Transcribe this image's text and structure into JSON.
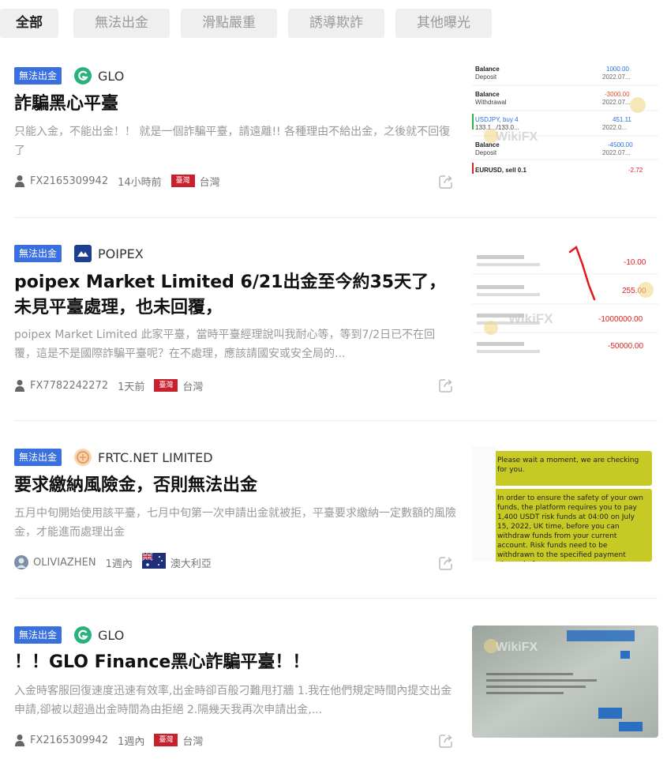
{
  "tabs": [
    {
      "label": "全部",
      "active": true
    },
    {
      "label": "無法出金",
      "active": false
    },
    {
      "label": "滑點嚴重",
      "active": false
    },
    {
      "label": "誘導欺詐",
      "active": false
    },
    {
      "label": "其他曝光",
      "active": false
    }
  ],
  "posts": [
    {
      "badge": "無法出金",
      "broker": "GLO",
      "broker_logo": "glo-logo",
      "title": "詐騙黑心平臺",
      "desc": "只能入金，不能出金！！ 就是一個詐騙平臺，請遠離!! 各種理由不給出金，之後就不回復了",
      "user": "FX2165309942",
      "time": "14小時前",
      "region_flag": "臺灣",
      "region": "台灣",
      "thumb": {
        "watermark": "WikiFX",
        "rows": [
          {
            "k": "Balance",
            "s": "Deposit",
            "v": "1000.00",
            "d": "2022.07...",
            "color": "#2b6ee0"
          },
          {
            "k": "Balance",
            "s": "Withdrawal",
            "v": "-3000.00",
            "d": "2022.07...",
            "color": "#e05020"
          },
          {
            "k": "USDJPY, buy 4",
            "s": "133.1.../133.0...",
            "v": "451.11",
            "d": "2022.0...",
            "color": "#2b6ee0"
          },
          {
            "k": "Balance",
            "s": "Deposit",
            "v": "-4500.00",
            "d": "2022.07...",
            "color": "#2b6ee0"
          },
          {
            "k": "EURUSD, sell 0.1",
            "s": "",
            "v": "-2.72",
            "d": "",
            "color": "#e02020"
          }
        ]
      }
    },
    {
      "badge": "無法出金",
      "broker": "POIPEX",
      "broker_logo": "poipex-logo",
      "title": "poipex Market Limited 6/21出金至今約35天了，未見平臺處理，也未回覆，",
      "desc": "poipex Market Limited 此家平臺，當時平臺經理說叫我耐心等，等到7/2日已不在回覆，這是不是國際詐騙平臺呢？在不處理，應該請國安或安全局的...",
      "user": "FX7782242272",
      "time": "1天前",
      "region_flag": "臺灣",
      "region": "台灣",
      "thumb": {
        "watermark": "WikiFX",
        "values": [
          "-10.00",
          "255.00",
          "-1000000.00",
          "-50000.00"
        ]
      }
    },
    {
      "badge": "無法出金",
      "broker": "FRTC.NET LIMITED",
      "broker_logo": "frtc-logo",
      "title": "要求繳納風險金，否則無法出金",
      "desc": "五月中旬開始使用該平臺，七月中旬第一次申請出金就被拒，平臺要求繳納一定數額的風險金，才能進而處理出金",
      "user": "OLIVIAZHEN",
      "time": "1週內",
      "region_flag": "australia-flag",
      "region": "澳大利亞",
      "thumb": {
        "msg1": "Please wait a moment, we are checking for you.",
        "msg2": "In order to ensure the safety of your own funds, the platform requires you to pay 1,400 USDT risk funds at 04:00 on July 15, 2022, UK time, before you can withdraw funds from your current account. Risk funds need to be withdrawn to the specified payment channel of our"
      }
    },
    {
      "badge": "無法出金",
      "broker": "GLO",
      "broker_logo": "glo-logo",
      "title": "！！GLO Finance黑心詐騙平臺！！",
      "desc": "入金時客服回復速度迅速有效率,出金時卻百般刁難甩打牆 1.我在他們規定時間內提交出金申請,卻被以超過出金時間為由拒絕 2.隔幾天我再次申請出金,...",
      "user": "FX2165309942",
      "time": "1週內",
      "region_flag": "臺灣",
      "region": "台灣",
      "thumb": {
        "watermark": "WikiFX"
      }
    }
  ]
}
